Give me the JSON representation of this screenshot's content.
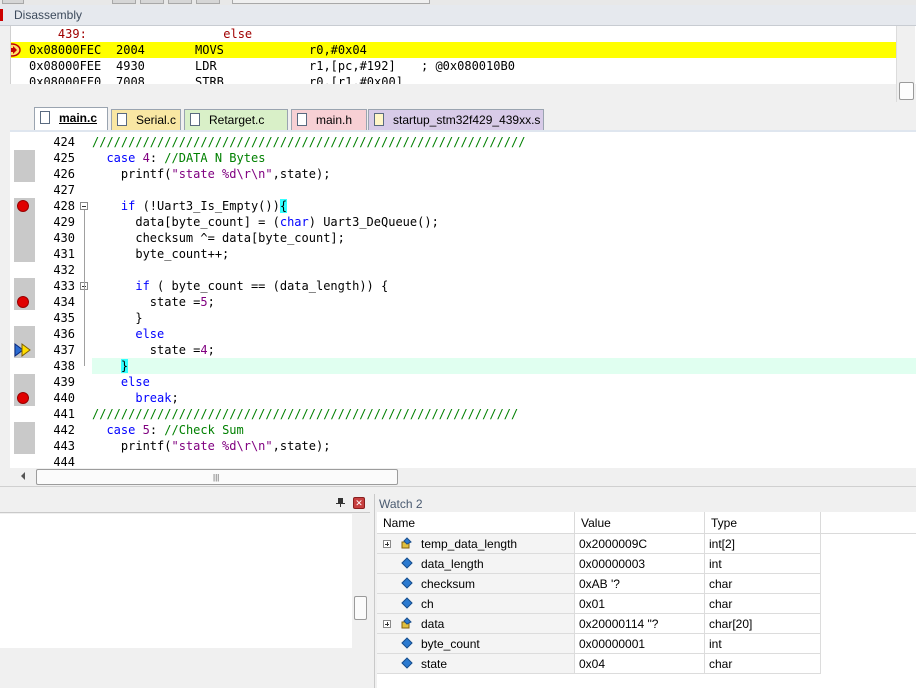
{
  "disassembly": {
    "title": "Disassembly",
    "lines": [
      {
        "addr": "    439:",
        "bytes": "",
        "mnem": "          else",
        "ops": "",
        "comment": "",
        "current": false,
        "source": true
      },
      {
        "addr": "0x08000FEC",
        "bytes": "2004",
        "mnem": "MOVS",
        "ops": "r0,#0x04",
        "comment": "",
        "current": true,
        "source": false
      },
      {
        "addr": "0x08000FEE",
        "bytes": "4930",
        "mnem": "LDR",
        "ops": "r1,[pc,#192]",
        "comment": "; @0x080010B0",
        "current": false,
        "source": false
      },
      {
        "addr": "0x08000FF0",
        "bytes": "7008",
        "mnem": "STRB",
        "ops": "r0,[r1,#0x00]",
        "comment": "",
        "current": false,
        "source": false
      }
    ]
  },
  "tabs": [
    {
      "label": "main.c",
      "active": true,
      "color": "#ffffff"
    },
    {
      "label": "Serial.c",
      "active": false,
      "color": "#f9e7a3"
    },
    {
      "label": "Retarget.c",
      "active": false,
      "color": "#d9f0c8"
    },
    {
      "label": "main.h",
      "active": false,
      "color": "#f7d0d4"
    },
    {
      "label": "startup_stm32f429_439xx.s",
      "active": false,
      "color": "#d8cbe8"
    }
  ],
  "editor": {
    "lines": [
      {
        "num": "424",
        "code": "////////////////////////////////////////////////////////////"
      },
      {
        "num": "425",
        "code": "  case 4: //DATA N Bytes"
      },
      {
        "num": "426",
        "code": "    printf(\"state %d\\r\\n\",state);"
      },
      {
        "num": "427",
        "code": ""
      },
      {
        "num": "428",
        "code": "    if (!Uart3_Is_Empty()){"
      },
      {
        "num": "429",
        "code": "      data[byte_count] = (char) Uart3_DeQueue();"
      },
      {
        "num": "430",
        "code": "      checksum ^= data[byte_count];"
      },
      {
        "num": "431",
        "code": "      byte_count++;"
      },
      {
        "num": "432",
        "code": ""
      },
      {
        "num": "433",
        "code": "      if ( byte_count == (data_length)) {"
      },
      {
        "num": "434",
        "code": "        state =5;"
      },
      {
        "num": "435",
        "code": "      }"
      },
      {
        "num": "436",
        "code": "      else"
      },
      {
        "num": "437",
        "code": "        state =4;"
      },
      {
        "num": "438",
        "code": "    }"
      },
      {
        "num": "439",
        "code": "    else"
      },
      {
        "num": "440",
        "code": "      break;"
      },
      {
        "num": "441",
        "code": "///////////////////////////////////////////////////////////"
      },
      {
        "num": "442",
        "code": "  case 5: //Check Sum"
      },
      {
        "num": "443",
        "code": "    printf(\"state %d\\r\\n\",state);"
      },
      {
        "num": "444",
        "code": ""
      }
    ],
    "breakpoints": [
      "428",
      "434",
      "440"
    ],
    "current_line": "437",
    "highlight_line": "438"
  },
  "watch": {
    "title": "Watch 2",
    "headers": {
      "name": "Name",
      "value": "Value",
      "type": "Type"
    },
    "rows": [
      {
        "name": "temp_data_length",
        "value": "0x2000009C",
        "type": "int[2]",
        "expandable": true
      },
      {
        "name": "data_length",
        "value": "0x00000003",
        "type": "int",
        "expandable": false
      },
      {
        "name": "checksum",
        "value": "0xAB '?",
        "type": "char",
        "expandable": false
      },
      {
        "name": "ch",
        "value": "0x01",
        "type": "char",
        "expandable": false
      },
      {
        "name": "data",
        "value": "0x20000114 \"?",
        "type": "char[20]",
        "expandable": true
      },
      {
        "name": "byte_count",
        "value": "0x00000001",
        "type": "int",
        "expandable": false
      },
      {
        "name": "state",
        "value": "0x04",
        "type": "char",
        "expandable": false
      }
    ]
  },
  "colors": {
    "current_line": "#ffff00",
    "breakpoint": "#e00000",
    "keyword": "#0000ff",
    "comment": "#008000",
    "string": "#800080"
  },
  "icons": {
    "pin": "pin-icon",
    "close": "close-icon",
    "execution": "execution-arrow-icon",
    "variable": "variable-icon",
    "struct": "struct-icon"
  }
}
